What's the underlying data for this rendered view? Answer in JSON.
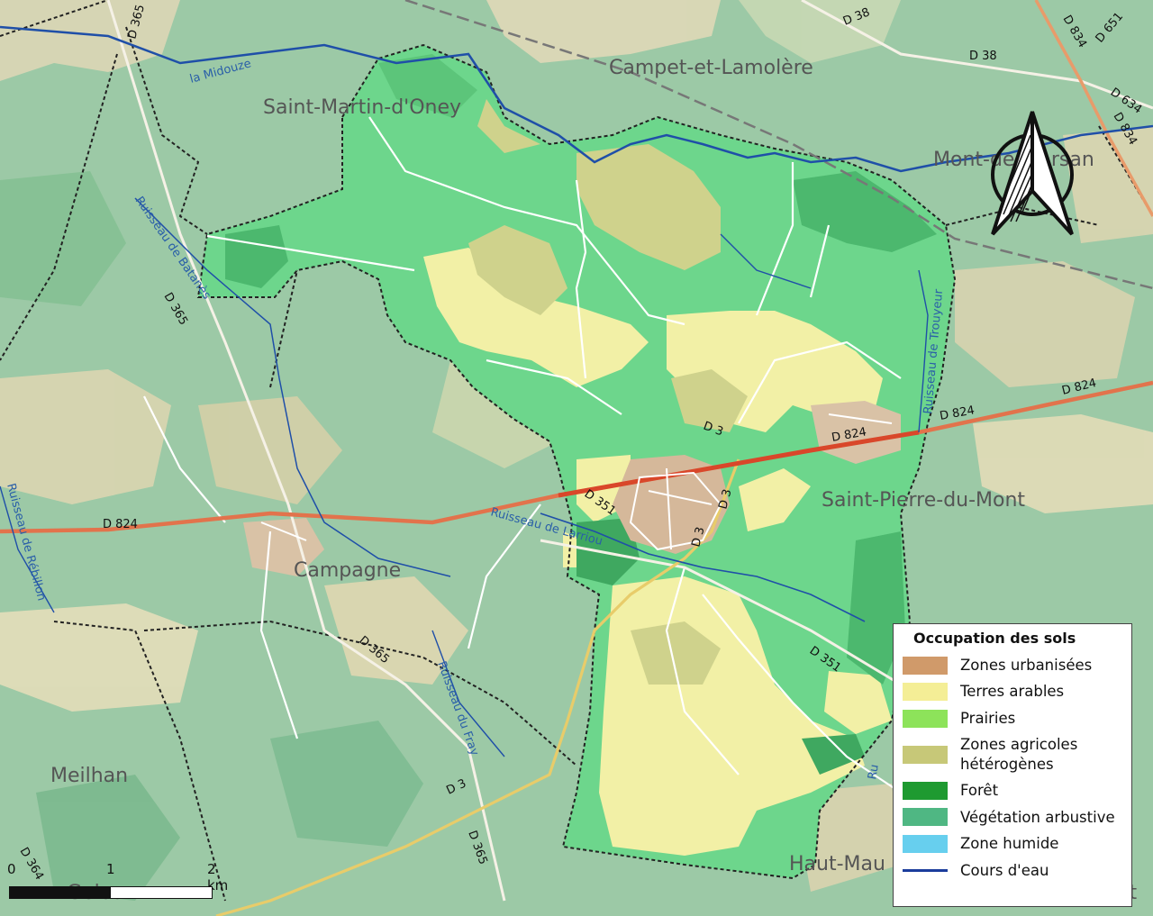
{
  "colors": {
    "background": "#9cc9a6",
    "commune_green": "#6dd68c",
    "arable": "#f2f0a6",
    "heterogeneous": "#cfd28c",
    "urban": "#d5b89a",
    "forest_dark": "#4cb86e",
    "river": "#1f4fa8",
    "road_main": "#e2734c"
  },
  "places": {
    "campet": "Campet-et-Lamolère",
    "saint_martin": "Saint-Martin-d'Oney",
    "mont": "Mont-de-Marsan",
    "saint_pierre": "Saint-Pierre-du-Mont",
    "campagne": "Campagne",
    "meilhan": "Meilhan",
    "haut_mauco": "Haut-Mau",
    "bottom_left_town": "Geloux",
    "right_edge": "et"
  },
  "roads": {
    "d365_top": "D 365",
    "d38_a": "D 38",
    "d38_b": "D 38",
    "d834_a": "D 834",
    "d651": "D 651",
    "d634": "D 634",
    "d834_b": "D 834",
    "d824_east": "D 824",
    "d824_mid": "D 824",
    "d824_mid2": "D 824",
    "d824_west": "D 824",
    "d3_north": "D 3",
    "d3_a": "D 3",
    "d3_b": "D 3",
    "d351_a": "D 351",
    "d351_b": "D 351",
    "d365_left": "D 365",
    "d365_mid": "D 365",
    "d3_south": "D 3",
    "d365_south": "D 365",
    "d364": "D 364"
  },
  "waterways": {
    "midouze": "la Midouze",
    "batanes": "Ruisseau de Batanès",
    "larriou": "Ruisseau de Larriou",
    "fray": "Ruisseau du Fray",
    "rebillon": "Ruisseau de Rébillon",
    "trouyeur": "Ruisseau de Trouyeur",
    "ru_fragment": "Ru"
  },
  "legend": {
    "title": "Occupation des sols",
    "items": [
      {
        "label": "Zones urbanisées",
        "color": "#d09a6a",
        "kind": "swatch"
      },
      {
        "label": "Terres arables",
        "color": "#f4ee96",
        "kind": "swatch"
      },
      {
        "label": "Prairies",
        "color": "#8de35a",
        "kind": "swatch"
      },
      {
        "label": "Zones agricoles hétérogènes",
        "color": "#c7c878",
        "kind": "swatch"
      },
      {
        "label": "Forêt",
        "color": "#1e9a30",
        "kind": "swatch"
      },
      {
        "label": "Végétation arbustive",
        "color": "#4fb783",
        "kind": "swatch"
      },
      {
        "label": "Zone humide",
        "color": "#67cfee",
        "kind": "swatch"
      },
      {
        "label": "Cours d'eau",
        "color": "#1b3d9c",
        "kind": "line"
      }
    ]
  },
  "scale": {
    "label_0": "0",
    "label_1": "1",
    "label_2": "2 km"
  }
}
